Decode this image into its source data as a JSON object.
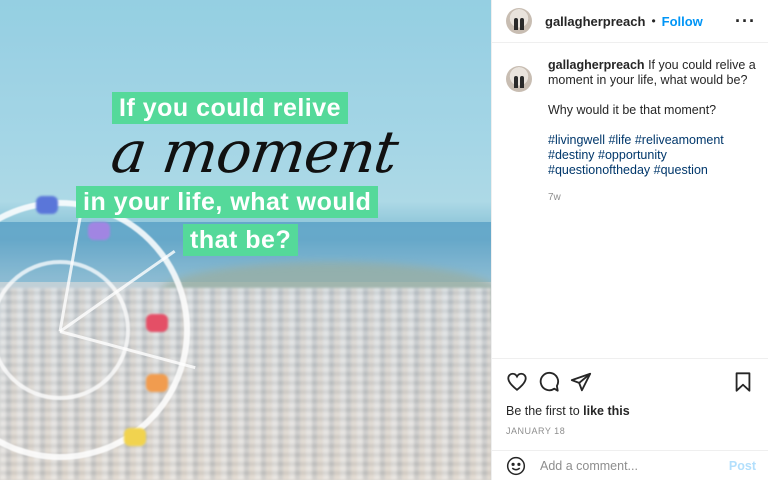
{
  "post_image": {
    "line1": "If you could relive",
    "line2": "a moment",
    "line3": "in your life, what would",
    "line4": "that be?",
    "highlight_color": "#55d99a"
  },
  "header": {
    "username": "gallagherpreach",
    "separator": "•",
    "follow_label": "Follow",
    "more_icon": "more-horizontal-icon"
  },
  "caption": {
    "username": "gallagherpreach",
    "text": "If you could relive a moment in your life, what would be?",
    "question": "Why would it be that moment?",
    "hashtags_line1": "#livingwell #life #reliveamoment",
    "hashtags_line2": "#destiny #opportunity",
    "hashtags_line3": "#questionoftheday #question",
    "time_ago": "7w"
  },
  "actions": {
    "icons": [
      "heart-icon",
      "comment-icon",
      "share-icon",
      "bookmark-icon"
    ]
  },
  "likes": {
    "prefix": "Be the first to ",
    "link": "like this"
  },
  "date": "JANUARY 18",
  "comment_box": {
    "emoji_icon": "emoji-icon",
    "placeholder": "Add a comment...",
    "post_label": "Post"
  },
  "colors": {
    "link_blue": "#0095f6",
    "hashtag": "#00376b",
    "muted": "#8e8e8e"
  }
}
